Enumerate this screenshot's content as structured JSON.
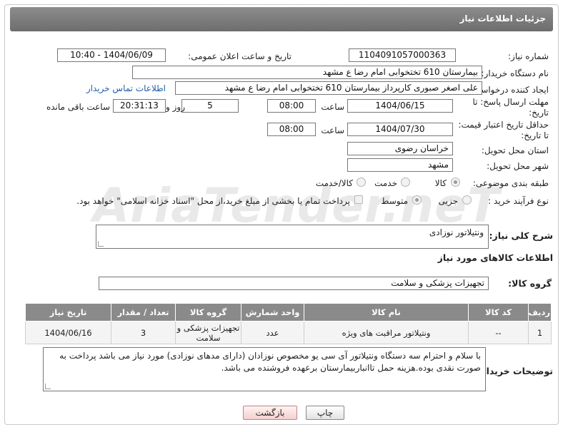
{
  "header": {
    "title": "جزئیات اطلاعات نیاز"
  },
  "watermark": {
    "text": "AriaTender.neT"
  },
  "form": {
    "need_number_label": "شماره نیاز:",
    "need_number": "1104091057000363",
    "announce_label": "تاریخ و ساعت اعلان عمومی:",
    "announce_value": "1404/06/09 - 10:40",
    "buyer_org_label": "نام دستگاه خریدار:",
    "buyer_org": "بیمارستان 610 تختخوابی امام رضا ع  مشهد",
    "creator_label": "ایجاد کننده درخواست:",
    "creator": "علی اصغر صبوری کارپرداز بیمارستان 610 تختخوابی امام رضا ع  مشهد",
    "contact_link": "اطلاعات تماس خریدار",
    "send_deadline_label": "مهلت ارسال پاسخ: تا تاریخ:",
    "send_date": "1404/06/15",
    "time_label": "ساعت",
    "send_time": "08:00",
    "days": "5",
    "days_label": "روز و",
    "remaining_time": "20:31:13",
    "remaining_label": "ساعت باقی مانده",
    "price_deadline_label": "حداقل تاریخ اعتبار قیمت: تا تاریخ:",
    "price_date": "1404/07/30",
    "price_time": "08:00",
    "province_label": "استان محل تحویل:",
    "province": "خراسان رضوی",
    "city_label": "شهر محل تحویل:",
    "city": "مشهد",
    "category_label": "طبقه بندی موضوعی:",
    "category_options": [
      "کالا",
      "خدمت",
      "کالا/خدمت"
    ],
    "category_selected": "کالا",
    "process_label": "نوع فرآیند خرید :",
    "process_options": [
      "جزیی",
      "متوسط"
    ],
    "process_selected": "متوسط",
    "payment_note": "پرداخت تمام یا بخشی از مبلغ خرید،از محل \"اسناد خزانه اسلامی\" خواهد بود."
  },
  "summary": {
    "label": "شرح کلی نیاز:",
    "value": "ونتیلاتور نوزادی"
  },
  "goods": {
    "section_title": "اطلاعات کالاهای مورد نیاز",
    "group_label": "گروه کالا:",
    "group_value": "تجهیزات پزشکی و سلامت",
    "table": {
      "headers": [
        "ردیف",
        "کد کالا",
        "نام کالا",
        "واحد شمارش",
        "گروه کالا",
        "تعداد / مقدار",
        "تاریخ نیاز"
      ],
      "rows": [
        [
          "1",
          "--",
          "ونتیلاتور مراقبت های ویژه",
          "عدد",
          "تجهیزات پزشکی و سلامت",
          "3",
          "1404/06/16"
        ]
      ]
    }
  },
  "buyer_notes": {
    "label": "توضیحات خریدار:",
    "value": "با سلام و احترام سه دستگاه ونتیلاتور آی سی یو مخصوص نوزادان (دارای مدهای نوزادی) مورد نیاز می باشد پرداخت به صورت نقدی بوده.هزینه حمل تاانباربیمارستان برعهده فروشنده می باشد."
  },
  "buttons": {
    "print": "چاپ",
    "back": "بازگشت"
  }
}
